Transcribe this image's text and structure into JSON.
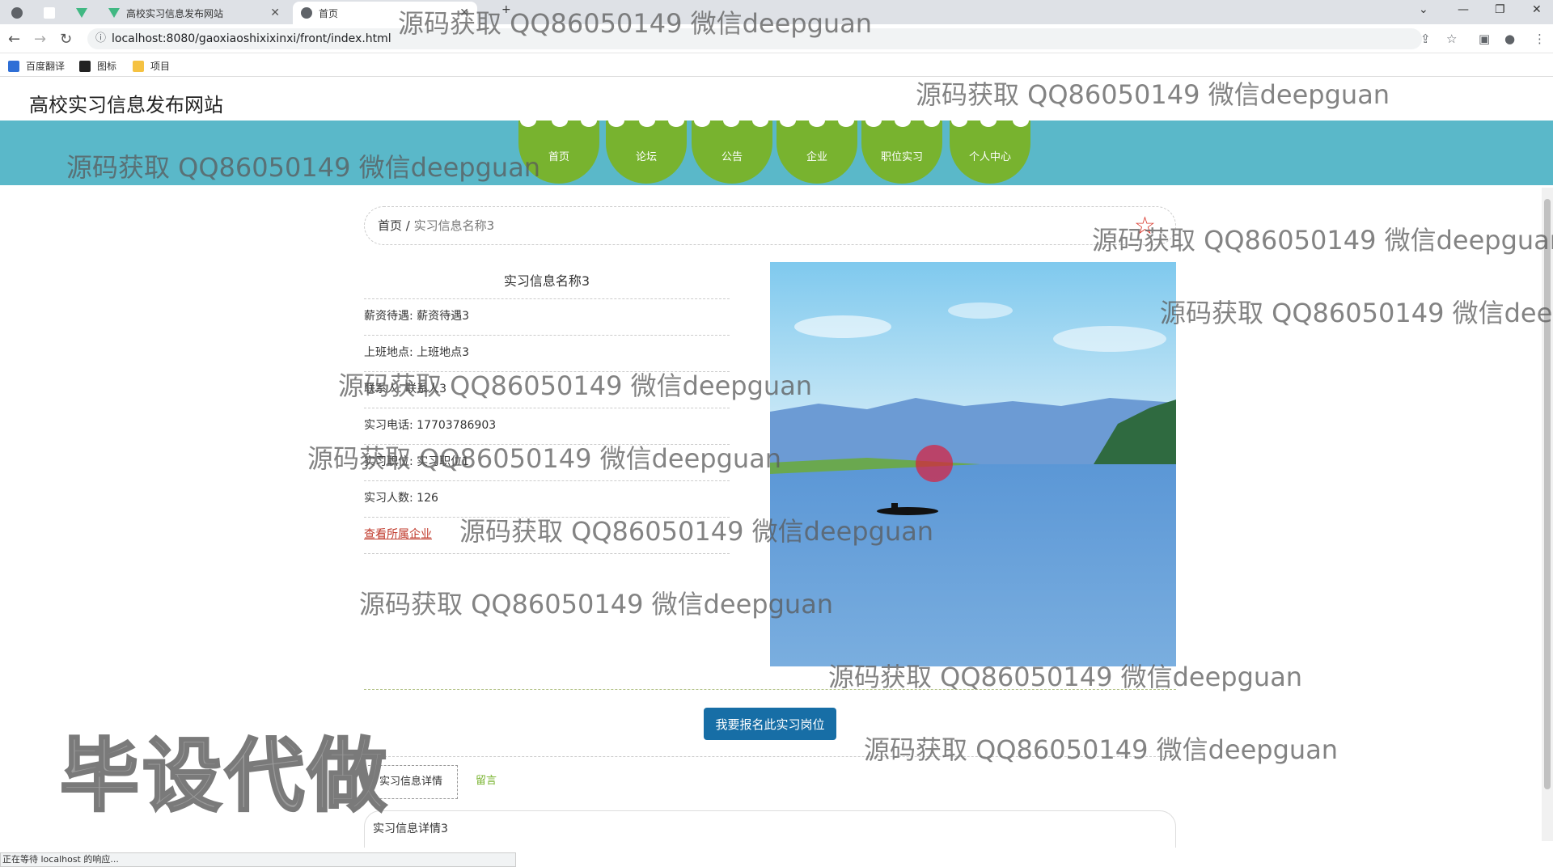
{
  "browser": {
    "tabs": [
      {
        "label": ""
      },
      {
        "label": ""
      },
      {
        "label": "高校实习信息发布网站"
      },
      {
        "label": "首页"
      }
    ],
    "url": "localhost:8080/gaoxiaoshixixinxi/front/index.html",
    "bookmarks": [
      "百度翻译",
      "图标",
      "项目"
    ],
    "status": "正在等待 localhost 的响应..."
  },
  "site": {
    "title": "高校实习信息发布网站",
    "nav": [
      "首页",
      "论坛",
      "公告",
      "企业",
      "职位实习",
      "个人中心"
    ]
  },
  "breadcrumb": {
    "home": "首页",
    "sep": " / ",
    "current": "实习信息名称3"
  },
  "detail": {
    "title": "实习信息名称3",
    "rows": [
      "薪资待遇: 薪资待遇3",
      "上班地点: 上班地点3",
      "联系人: 联系人3",
      "实习电话: 17703786903",
      "实习职位: 实习职位1",
      "实习人数: 126"
    ],
    "company_link": "查看所属企业"
  },
  "apply_button": "我要报名此实习岗位",
  "tabs": {
    "detail": "实习信息详情",
    "comment": "留言"
  },
  "detail_text": "实习信息详情3",
  "watermarks": [
    "源码获取 QQ86050149 微信deepguan",
    "毕设代做"
  ],
  "colors": {
    "band": "#5ab8c9",
    "nav": "#78b32f",
    "button": "#176ea6",
    "link": "#c0392b"
  }
}
